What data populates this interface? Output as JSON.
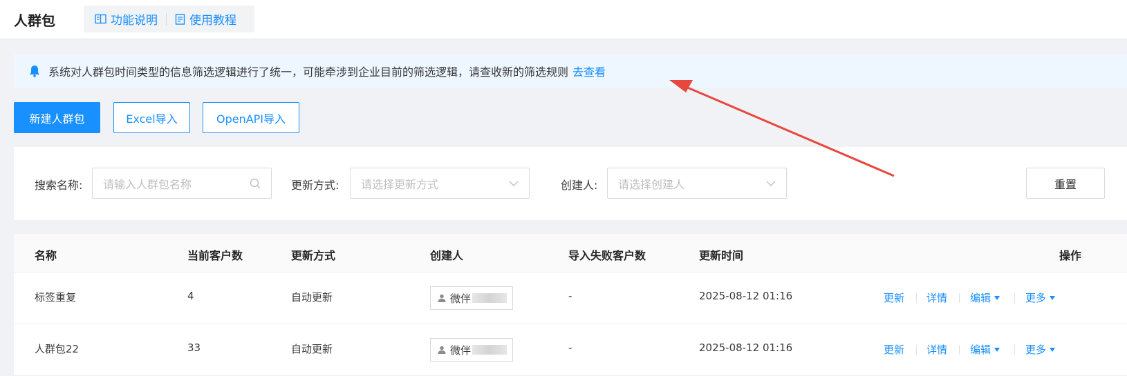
{
  "header": {
    "title": "人群包",
    "links": [
      {
        "label": "功能说明",
        "icon": "book-icon"
      },
      {
        "label": "使用教程",
        "icon": "document-icon"
      }
    ]
  },
  "notice": {
    "text": "系统对人群包时间类型的信息筛选逻辑进行了统一，可能牵涉到企业目前的筛选逻辑，请查收新的筛选规则",
    "link": "去查看",
    "icon": "bell-icon"
  },
  "actions": {
    "new": "新建人群包",
    "excel": "Excel导入",
    "openapi": "OpenAPI导入"
  },
  "filters": {
    "search_label": "搜索名称:",
    "search_placeholder": "请输入人群包名称",
    "update_label": "更新方式:",
    "update_placeholder": "请选择更新方式",
    "creator_label": "创建人:",
    "creator_placeholder": "请选择创建人",
    "reset": "重置"
  },
  "table": {
    "columns": [
      "名称",
      "当前客户数",
      "更新方式",
      "创建人",
      "导入失败客户数",
      "更新时间",
      "操作"
    ],
    "rows": [
      {
        "name": "标签重复",
        "count": "4",
        "mode": "自动更新",
        "creator": "微伴",
        "failed": "-",
        "time": "2025-08-12 01:16"
      },
      {
        "name": "人群包22",
        "count": "33",
        "mode": "自动更新",
        "creator": "微伴",
        "failed": "-",
        "time": "2025-08-12 01:16"
      }
    ],
    "ops": {
      "update": "更新",
      "detail": "详情",
      "edit": "编辑",
      "more": "更多"
    }
  },
  "colors": {
    "accent": "#1890ff",
    "annotation_arrow": "#e8473d"
  }
}
